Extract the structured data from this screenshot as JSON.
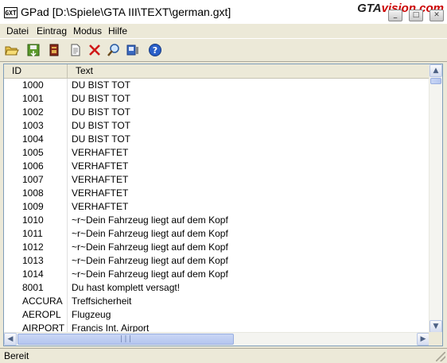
{
  "window": {
    "title": "GPad [D:\\Spiele\\GTA III\\TEXT\\german.gxt]",
    "app_icon_text": "GXT",
    "watermark": {
      "part1": "GTA",
      "part2": "vision.com"
    },
    "caption_buttons": {
      "minimize": "_",
      "maximize": "□",
      "close": "✕"
    }
  },
  "menu": [
    "Datei",
    "Eintrag",
    "Modus",
    "Hilfe"
  ],
  "toolbar": [
    {
      "icon": "open-folder-icon"
    },
    {
      "icon": "save-icon"
    },
    {
      "icon": "book-icon"
    },
    {
      "icon": "document-icon"
    },
    {
      "icon": "delete-icon"
    },
    {
      "icon": "search-icon"
    },
    {
      "icon": "properties-icon"
    },
    {
      "icon": "help-icon"
    }
  ],
  "list": {
    "columns": [
      "ID",
      "Text"
    ],
    "rows": [
      {
        "id": "1000",
        "text": "DU BIST TOT"
      },
      {
        "id": "1001",
        "text": "DU BIST TOT"
      },
      {
        "id": "1002",
        "text": "DU BIST TOT"
      },
      {
        "id": "1003",
        "text": "DU BIST TOT"
      },
      {
        "id": "1004",
        "text": "DU BIST TOT"
      },
      {
        "id": "1005",
        "text": "VERHAFTET"
      },
      {
        "id": "1006",
        "text": "VERHAFTET"
      },
      {
        "id": "1007",
        "text": "VERHAFTET"
      },
      {
        "id": "1008",
        "text": "VERHAFTET"
      },
      {
        "id": "1009",
        "text": "VERHAFTET"
      },
      {
        "id": "1010",
        "text": "~r~Dein Fahrzeug liegt auf dem Kopf"
      },
      {
        "id": "1011",
        "text": "~r~Dein Fahrzeug liegt auf dem Kopf"
      },
      {
        "id": "1012",
        "text": "~r~Dein Fahrzeug liegt auf dem Kopf"
      },
      {
        "id": "1013",
        "text": "~r~Dein Fahrzeug liegt auf dem Kopf"
      },
      {
        "id": "1014",
        "text": "~r~Dein Fahrzeug liegt auf dem Kopf"
      },
      {
        "id": "8001",
        "text": "Du hast komplett versagt!"
      },
      {
        "id": "ACCURA",
        "text": "Treffsicherheit"
      },
      {
        "id": "AEROPL",
        "text": "Flugzeug"
      },
      {
        "id": "AIRPORT",
        "text": "Francis Int. Airport"
      }
    ],
    "scroll_arrows": {
      "up": "▲",
      "down": "▼",
      "left": "◀",
      "right": "▶"
    },
    "hthumb_grip": "|||"
  },
  "status": {
    "text": "Bereit"
  }
}
